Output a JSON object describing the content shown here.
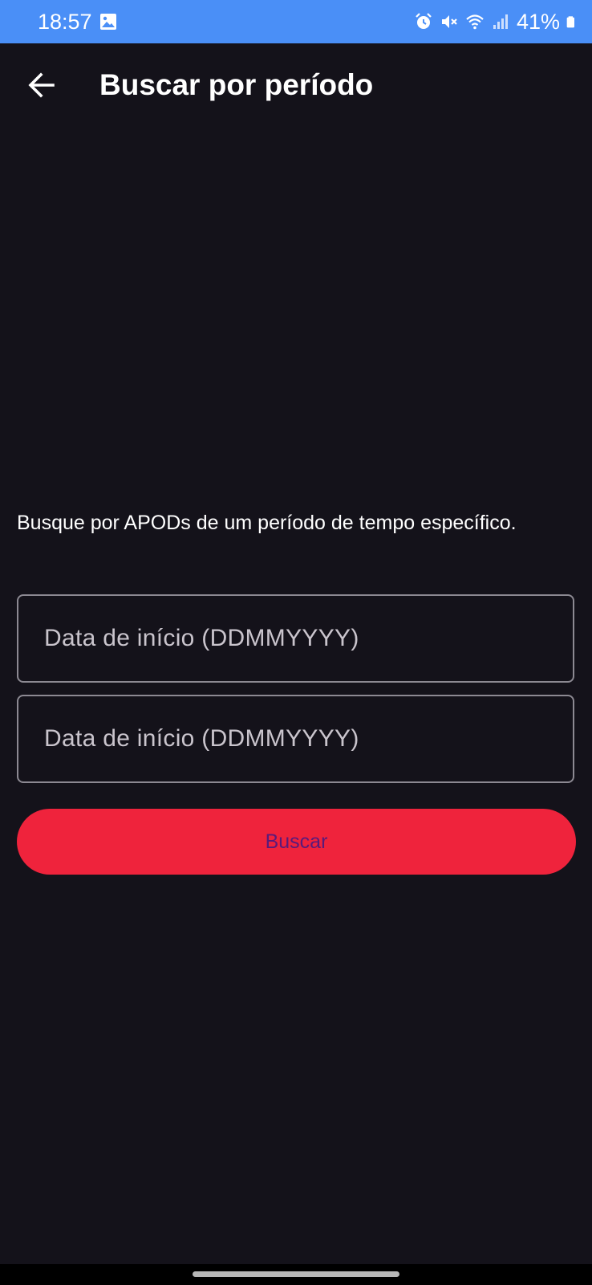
{
  "status_bar": {
    "time": "18:57",
    "battery": "41%",
    "icons": [
      "image-icon",
      "alarm-icon",
      "mute-icon",
      "wifi-icon",
      "signal-icon",
      "battery-icon"
    ]
  },
  "header": {
    "title": "Buscar por período",
    "back_icon": "arrow-left-icon"
  },
  "main": {
    "description": "Busque por APODs de um período de tempo específico.",
    "start_date": {
      "placeholder": "Data de início (DDMMYYYY)",
      "value": ""
    },
    "end_date": {
      "placeholder": "Data de início (DDMMYYYY)",
      "value": ""
    },
    "search_label": "Buscar"
  },
  "colors": {
    "status_bar": "#4a8ff7",
    "background": "#14121a",
    "button": "#ef233c",
    "button_text": "#5a1a7a"
  }
}
